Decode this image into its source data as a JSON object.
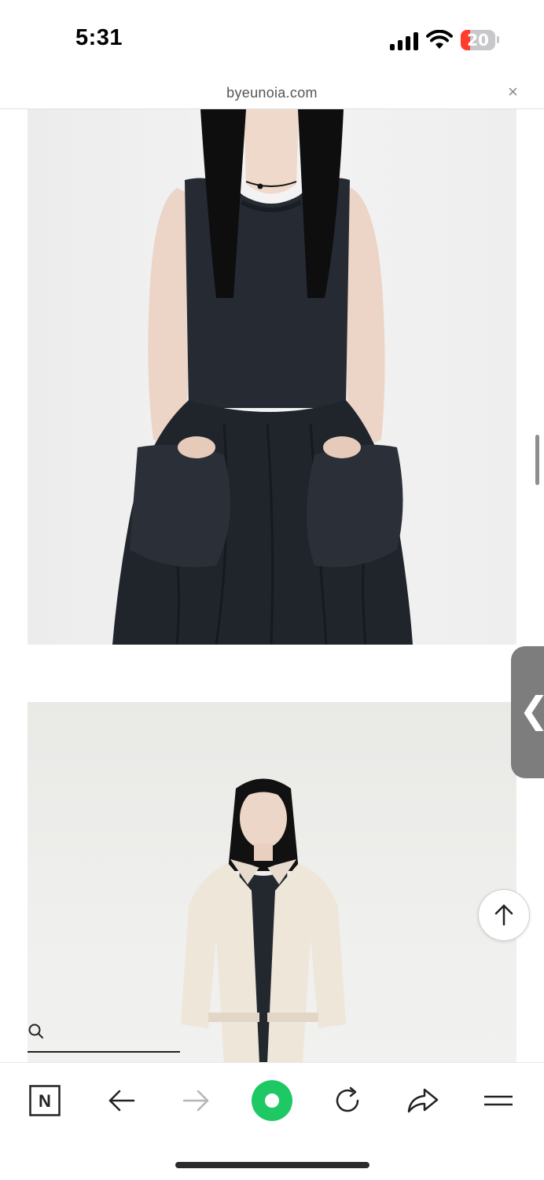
{
  "status_bar": {
    "time": "5:31",
    "battery_level": "20",
    "battery_fraction": 0.2,
    "icons": [
      "cellular-signal-icon",
      "wifi-icon",
      "battery-icon"
    ]
  },
  "browser": {
    "url": "byeunoia.com",
    "close_label": "×"
  },
  "content": {
    "images": [
      {
        "name": "product-photo-black-dress",
        "description_icon": "photo"
      },
      {
        "name": "product-photo-cream-jacket",
        "description_icon": "photo"
      }
    ],
    "side_handle_label": "❮"
  },
  "toolbar": {
    "items": [
      {
        "name": "naver-home-button",
        "icon": "n-box-icon",
        "label": "N"
      },
      {
        "name": "back-button",
        "icon": "arrow-left-icon"
      },
      {
        "name": "forward-button",
        "icon": "arrow-right-icon",
        "disabled": true
      },
      {
        "name": "green-dot-button",
        "icon": "green-ring-icon",
        "color": "#1ec864"
      },
      {
        "name": "reload-button",
        "icon": "reload-icon"
      },
      {
        "name": "share-button",
        "icon": "share-arrow-icon"
      },
      {
        "name": "menu-button",
        "icon": "menu-icon"
      }
    ]
  },
  "colors": {
    "accent_green": "#1ec864",
    "battery_red": "#ff3b30"
  }
}
